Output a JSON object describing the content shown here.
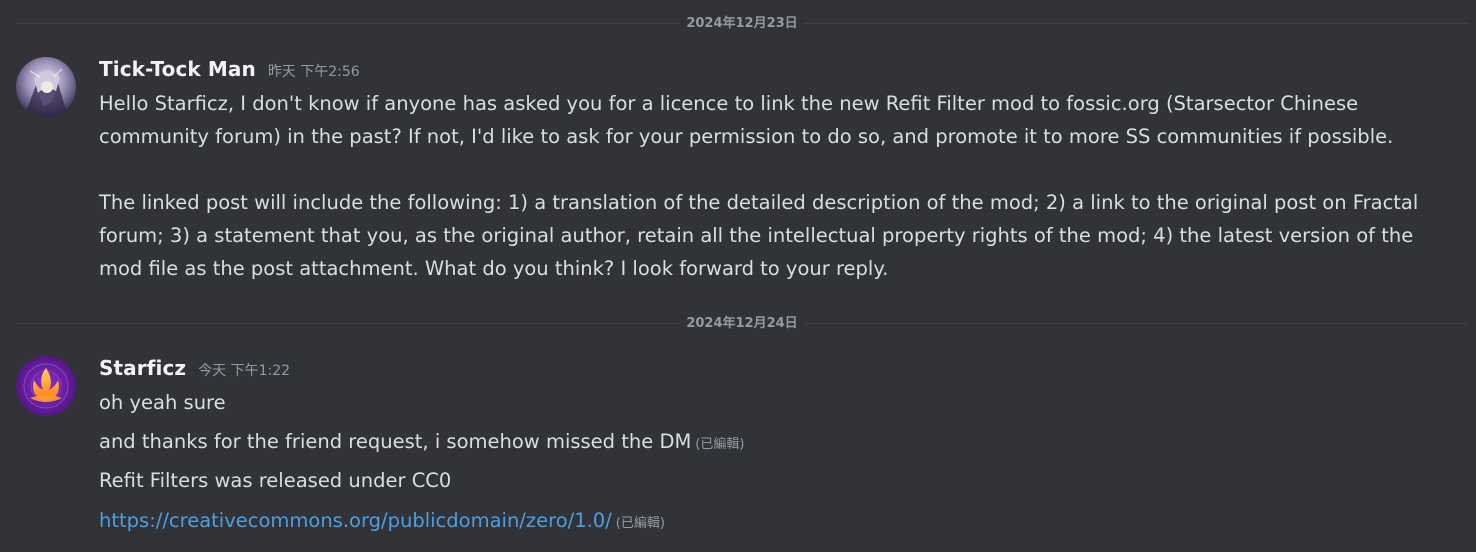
{
  "dividers": [
    {
      "label": "2024年12月23日"
    },
    {
      "label": "2024年12月24日"
    }
  ],
  "messages": [
    {
      "username": "Tick-Tock Man",
      "timestamp": "昨天 下午2:56",
      "lines": [
        "Hello Starficz, I don't know if anyone has asked you for a licence to link the new Refit Filter mod to fossic.org (Starsector Chinese",
        "community forum) in the past? If not, I'd like to ask for your permission to do so, and promote it to more SS communities if possible.",
        "",
        "The linked post will include the following: 1) a translation of the detailed description of the mod; 2) a link to the original post on Fractal",
        "forum; 3) a statement that you, as the original author, retain all the intellectual property rights of the mod; 4) the latest version of the",
        "mod file as the post attachment. What do you think? I look forward to your reply."
      ]
    },
    {
      "username": "Starficz",
      "timestamp": "今天 下午1:22",
      "line1": "oh yeah sure",
      "line2": "and thanks for the friend request, i somehow missed the DM",
      "line2_edited": "(已編輯)",
      "line3": "Refit Filters was released under CC0",
      "line4_link": "https://creativecommons.org/publicdomain/zero/1.0/",
      "line4_edited": "(已編輯)"
    }
  ],
  "colors": {
    "background": "#313338",
    "username": "#f2f3f5",
    "text": "#dbdee1",
    "muted": "#949ba4",
    "link": "#4d9fe0"
  },
  "icons": {
    "avatar1": "anime-character-avatar",
    "avatar2": "purple-flame-logo-avatar"
  }
}
